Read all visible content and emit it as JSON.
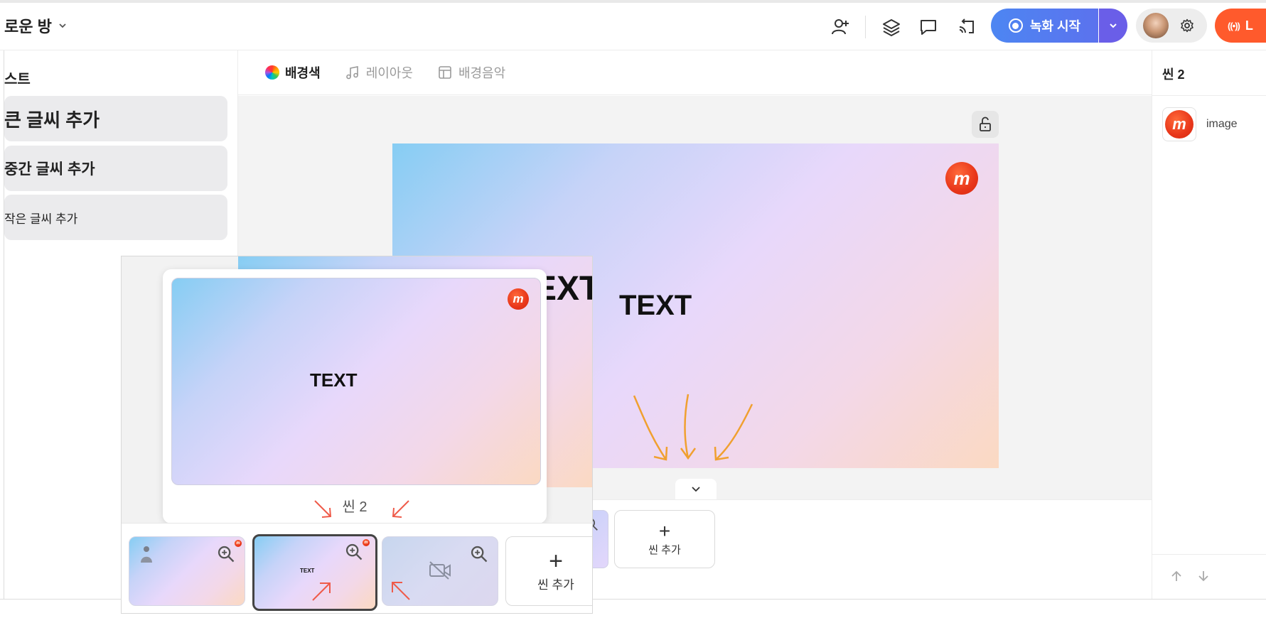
{
  "header": {
    "room_title": "로운 방",
    "record_label": "녹화 시작",
    "live_label": "L"
  },
  "sidebar": {
    "section_title": "스트",
    "items": [
      {
        "label": "큰 글씨 추가"
      },
      {
        "label": "중간 글씨 추가"
      },
      {
        "label": "작은 글씨 추가"
      }
    ]
  },
  "toolbar": {
    "items": [
      {
        "label": "배경색",
        "icon": "color-wheel-icon"
      },
      {
        "label": "레이아웃",
        "icon": "music-note-icon"
      },
      {
        "label": "배경음악",
        "icon": "layout-icon"
      }
    ]
  },
  "canvas": {
    "text": "TEXT",
    "behind_text": "EXT"
  },
  "right_panel": {
    "title": "씬 2",
    "layer_label": "image"
  },
  "popup": {
    "preview_text": "TEXT",
    "scene_label": "씬 2"
  },
  "scene_strip": {
    "thumb_text": "TEXT",
    "add_scene_label": "씬 추가"
  },
  "colors": {
    "record_blue": "#4a7ef0",
    "record_purple": "#6b5ce8",
    "live_orange": "#ff5a2c",
    "arrow_orange": "#f0a030",
    "arrow_red": "#ef5b4a",
    "logo_red": "#e8361a"
  }
}
